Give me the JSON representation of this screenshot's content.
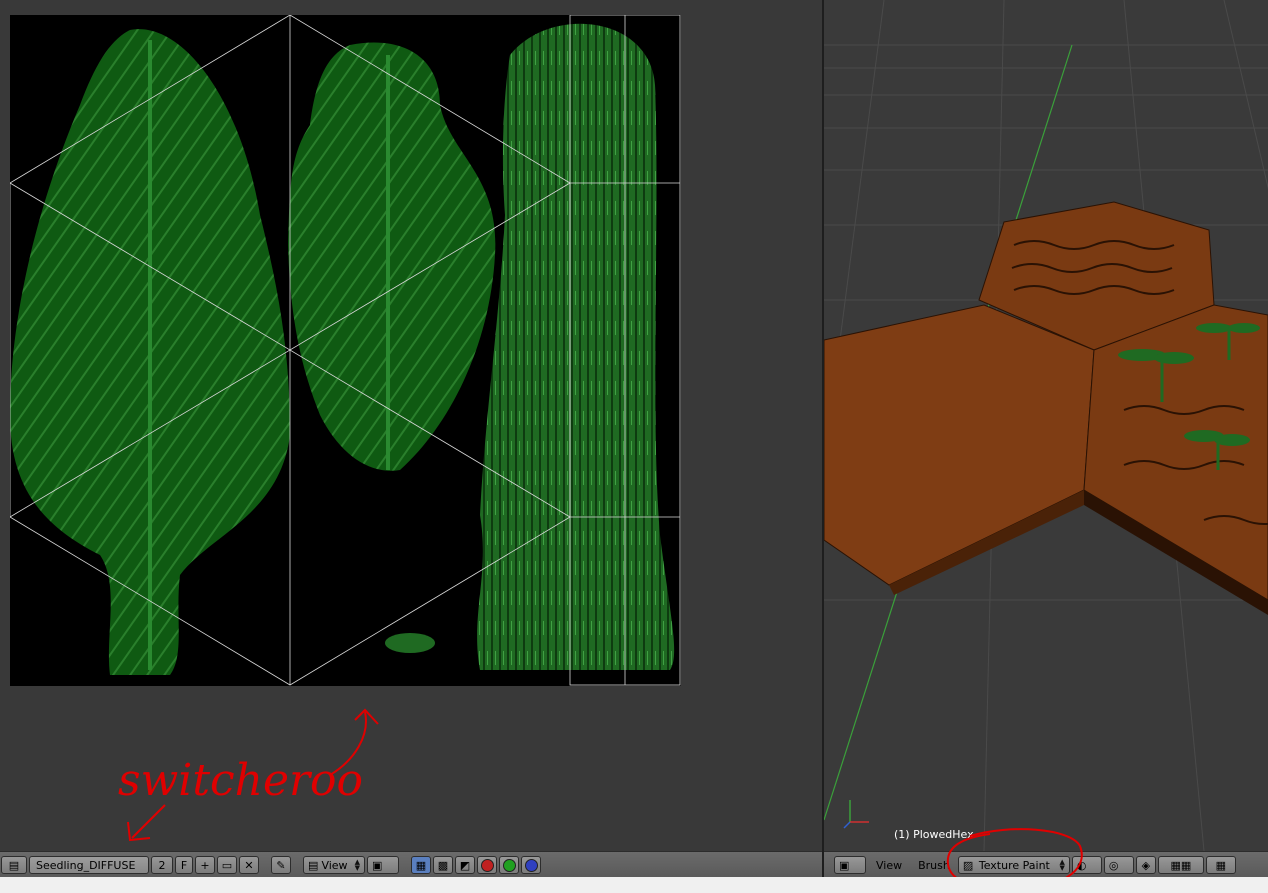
{
  "image_editor": {
    "image_name": "Seedling_DIFFUSE",
    "users": "2",
    "fake_user": "F",
    "view_menu": "View",
    "annotation_text": "switcheroo"
  },
  "viewport": {
    "object_info": "(1) PlowedHex",
    "view_menu": "View",
    "brush_menu": "Brush",
    "mode": "Texture Paint"
  },
  "colors": {
    "leaf_green": "#0f5a12",
    "vein_green": "#2a8a30",
    "soil_brown": "#7a3a12",
    "annotation_red": "#e00000",
    "grid_line": "#4a4a4a",
    "axis_green": "#3aa03a"
  },
  "icons": [
    "image-editor-type-icon",
    "new-image-icon",
    "open-image-icon",
    "unlink-icon",
    "pin-icon",
    "image-menu-icon",
    "mask-mode-icon",
    "checker-icon",
    "alpha-icon",
    "channel-icon",
    "color-red-icon",
    "color-green-icon",
    "color-blue-icon",
    "view3d-type-icon",
    "viewport-shading-icon",
    "pivot-icon",
    "manipulator-icon",
    "layer-icon"
  ]
}
